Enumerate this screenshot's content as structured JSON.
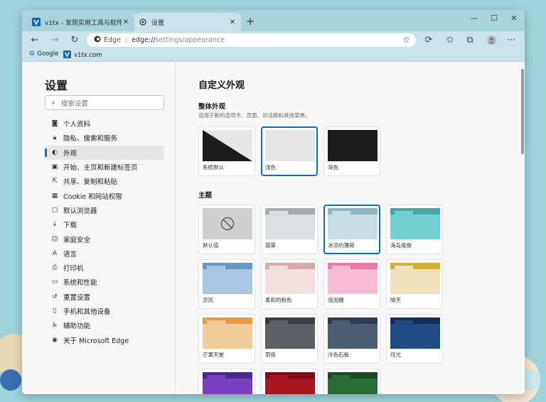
{
  "tabs": [
    {
      "label": "v1tx - 发现实用工具与软件",
      "favicon": "v1tx-logo-icon",
      "active": false
    },
    {
      "label": "设置",
      "favicon": "gear-icon",
      "active": true
    }
  ],
  "window_controls": {
    "minimize": "—",
    "maximize": "☐",
    "close": "✕",
    "new_tab": "+"
  },
  "toolbar": {
    "edge_label": "Edge",
    "url_host": "edge://",
    "url_path": "settings/appearance"
  },
  "bookmarks": [
    {
      "label": "Google",
      "icon": "google-icon"
    },
    {
      "label": "v1tx.com",
      "icon": "v1tx-logo-icon"
    }
  ],
  "sidebar": {
    "title": "设置",
    "search_placeholder": "搜索设置",
    "items": [
      {
        "label": "个人资料",
        "icon": "profile-icon",
        "glyph": "◙"
      },
      {
        "label": "隐私、搜索和服务",
        "icon": "lock-icon",
        "glyph": "🔒︎"
      },
      {
        "label": "外观",
        "icon": "appearance-icon",
        "glyph": "◐",
        "active": true
      },
      {
        "label": "开始、主页和新建标签页",
        "icon": "home-icon",
        "glyph": "▣"
      },
      {
        "label": "共享、复制和粘贴",
        "icon": "share-icon",
        "glyph": "⇱"
      },
      {
        "label": "Cookie 和网站权限",
        "icon": "cookie-icon",
        "glyph": "▦"
      },
      {
        "label": "默认浏览器",
        "icon": "browser-icon",
        "glyph": "▢"
      },
      {
        "label": "下载",
        "icon": "download-icon",
        "glyph": "↓"
      },
      {
        "label": "家庭安全",
        "icon": "family-icon",
        "glyph": "☺"
      },
      {
        "label": "语言",
        "icon": "language-icon",
        "glyph": "A"
      },
      {
        "label": "打印机",
        "icon": "printer-icon",
        "glyph": "⎙"
      },
      {
        "label": "系统和性能",
        "icon": "laptop-icon",
        "glyph": "▭"
      },
      {
        "label": "重置设置",
        "icon": "reset-icon",
        "glyph": "↺"
      },
      {
        "label": "手机和其他设备",
        "icon": "phone-icon",
        "glyph": "▯"
      },
      {
        "label": "辅助功能",
        "icon": "accessibility-icon",
        "glyph": "♿︎"
      },
      {
        "label": "关于 Microsoft Edge",
        "icon": "edge-logo-icon",
        "glyph": "◉"
      }
    ]
  },
  "main": {
    "title": "自定义外观",
    "overall": {
      "title": "整体外观",
      "subtitle": "适用于新的选项卡、页面、对话框和其他菜单。",
      "options": [
        {
          "label": "系统默认",
          "kind": "system",
          "selected": false
        },
        {
          "label": "浅色",
          "kind": "light",
          "selected": true
        },
        {
          "label": "深色",
          "kind": "dark",
          "selected": false
        }
      ]
    },
    "themes": {
      "title": "主题",
      "items": [
        {
          "label": "默认值",
          "kind": "default",
          "top": "#cfcfcf",
          "tab": "#cfcfcf",
          "body": "#cfcfcf",
          "selected": false
        },
        {
          "label": "晨雾",
          "top": "#a7adb3",
          "tab": "#dcdfe2",
          "body": "#dcdfe2",
          "selected": false
        },
        {
          "label": "冰凉的薄荷",
          "top": "#8cb8c2",
          "tab": "#c6dde2",
          "body": "#c6dde2",
          "selected": true
        },
        {
          "label": "海岛度假",
          "top": "#4aa7a8",
          "tab": "#73d0d2",
          "body": "#73d0d2",
          "selected": false
        },
        {
          "label": "凉风",
          "top": "#6897c2",
          "tab": "#a9c7e0",
          "body": "#a9c7e0",
          "selected": false
        },
        {
          "label": "柔和的粉色",
          "top": "#d7aba7",
          "tab": "#f1e0de",
          "body": "#f1e0de",
          "selected": false
        },
        {
          "label": "泡泡糖",
          "top": "#ea79a6",
          "tab": "#f9bcd4",
          "body": "#f9bcd4",
          "selected": false
        },
        {
          "label": "晴天",
          "top": "#d3ae3d",
          "tab": "#efe2bb",
          "body": "#efe2bb",
          "selected": false
        },
        {
          "label": "芒果天堂",
          "top": "#e79b3c",
          "tab": "#f2cb9a",
          "body": "#f2cb9a",
          "selected": false
        },
        {
          "label": "雨夜",
          "top": "#3a3d42",
          "tab": "#5b5e63",
          "body": "#5b5e63",
          "selected": false
        },
        {
          "label": "冷色石板",
          "top": "#2e3c52",
          "tab": "#4e5c72",
          "body": "#4e5c72",
          "selected": false
        },
        {
          "label": "月光",
          "top": "#132e58",
          "tab": "#1f4b85",
          "body": "#1f4b85",
          "selected": false
        },
        {
          "label": "",
          "top": "#4b2a8a",
          "tab": "#7a3fc0",
          "body": "#7a3fc0",
          "selected": false
        },
        {
          "label": "",
          "top": "#7a0f18",
          "tab": "#a8141f",
          "body": "#a8141f",
          "selected": false
        },
        {
          "label": "",
          "top": "#1d4a25",
          "tab": "#2b6b36",
          "body": "#2b6b36",
          "selected": false
        }
      ]
    }
  },
  "colors": {
    "accent": "#0f6cbd",
    "titlebar": "#a9d3da",
    "toolbar": "#c8e4e8"
  }
}
